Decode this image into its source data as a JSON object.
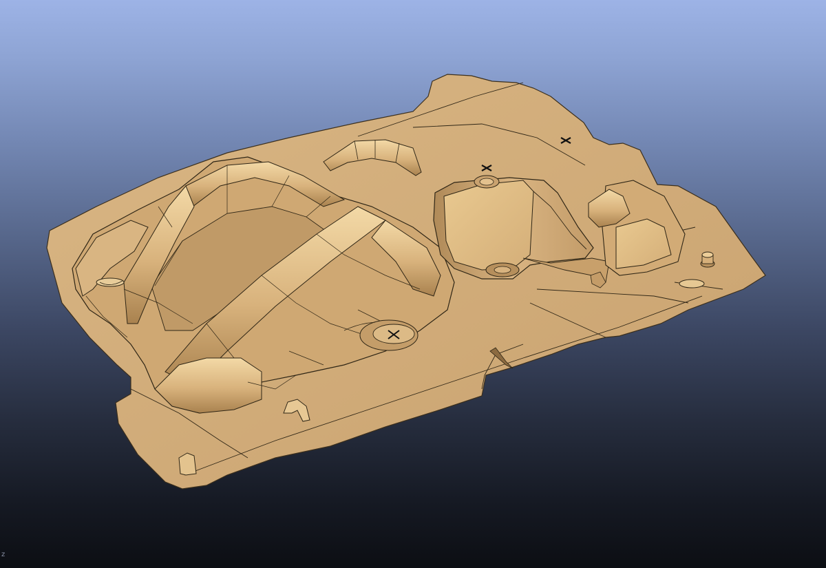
{
  "viewport": {
    "background_top": "#9db3e6",
    "background_bottom": "#0c0e13"
  },
  "model": {
    "part_color": "#d2ad7a",
    "part_shade": "#b8925f",
    "part_highlight": "#f2d6a2",
    "edge_color": "#2a2216"
  },
  "axis": {
    "label": "z"
  }
}
